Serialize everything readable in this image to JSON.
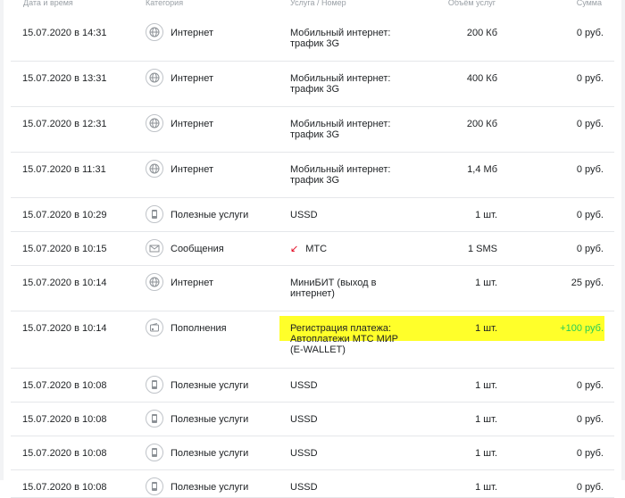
{
  "header": {
    "date": "Дата и время",
    "category": "Категория",
    "service": "Услуга / Номер",
    "volume": "Объём услуг",
    "sum": "Сумма"
  },
  "rows": [
    {
      "date": "15.07.2020 в 14:31",
      "category": "Интернет",
      "icon": "globe-icon",
      "service": "Мобильный интернет: трафик 3G",
      "volume": "200 Кб",
      "sum": "0 руб."
    },
    {
      "date": "15.07.2020 в 13:31",
      "category": "Интернет",
      "icon": "globe-icon",
      "service": "Мобильный интернет: трафик 3G",
      "volume": "400 Кб",
      "sum": "0 руб."
    },
    {
      "date": "15.07.2020 в 12:31",
      "category": "Интернет",
      "icon": "globe-icon",
      "service": "Мобильный интернет: трафик 3G",
      "volume": "200 Кб",
      "sum": "0 руб."
    },
    {
      "date": "15.07.2020 в 11:31",
      "category": "Интернет",
      "icon": "globe-icon",
      "service": "Мобильный интернет: трафик 3G",
      "volume": "1,4 Мб",
      "sum": "0 руб."
    },
    {
      "date": "15.07.2020 в 10:29",
      "category": "Полезные услуги",
      "icon": "phone-icon",
      "service": "USSD",
      "volume": "1 шт.",
      "sum": "0 руб."
    },
    {
      "date": "15.07.2020 в 10:15",
      "category": "Сообщения",
      "icon": "envelope-icon",
      "service": "МТС",
      "volume": "1 SMS",
      "sum": "0 руб."
    },
    {
      "date": "15.07.2020 в 10:14",
      "category": "Интернет",
      "icon": "globe-icon",
      "service": "МиниБИТ (выход в интернет)",
      "volume": "1 шт.",
      "sum": "25 руб."
    },
    {
      "date": "15.07.2020 в 10:14",
      "category": "Пополнения",
      "icon": "wallet-icon",
      "service": "Регистрация платежа: Автоплатежи МТС МИР (E-WALLET)",
      "volume": "1 шт.",
      "sum": "+100 руб."
    },
    {
      "date": "15.07.2020 в 10:08",
      "category": "Полезные услуги",
      "icon": "phone-icon",
      "service": "USSD",
      "volume": "1 шт.",
      "sum": "0 руб."
    },
    {
      "date": "15.07.2020 в 10:08",
      "category": "Полезные услуги",
      "icon": "phone-icon",
      "service": "USSD",
      "volume": "1 шт.",
      "sum": "0 руб."
    },
    {
      "date": "15.07.2020 в 10:08",
      "category": "Полезные услуги",
      "icon": "phone-icon",
      "service": "USSD",
      "volume": "1 шт.",
      "sum": "0 руб."
    },
    {
      "date": "15.07.2020 в 10:08",
      "category": "Полезные услуги",
      "icon": "phone-icon",
      "service": "USSD",
      "volume": "1 шт.",
      "sum": "0 руб."
    }
  ],
  "colors": {
    "positive": "#26cd58",
    "highlight": "#ffff2a",
    "arrow": "#e3001b"
  }
}
